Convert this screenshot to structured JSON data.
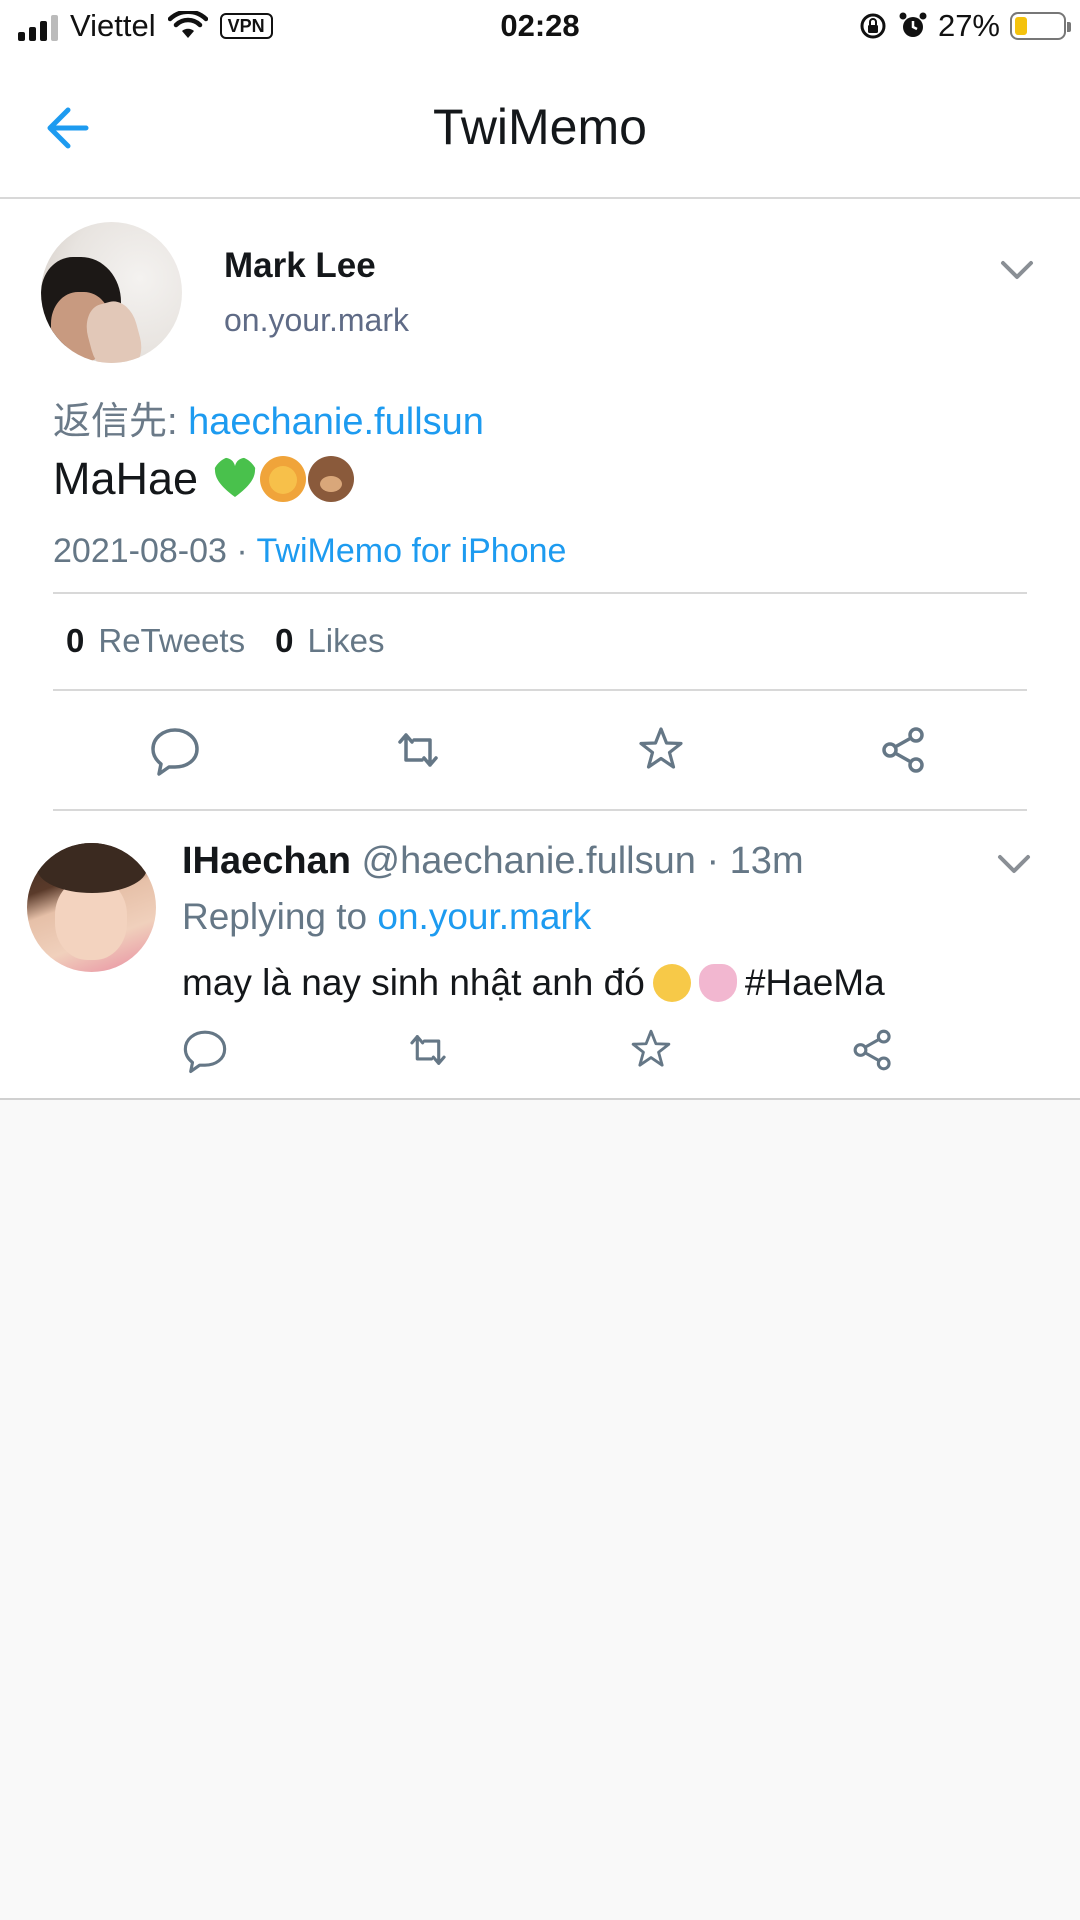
{
  "status_bar": {
    "carrier": "Viettel",
    "vpn": "VPN",
    "time": "02:28",
    "battery_percent": "27%",
    "battery_level": 0.27
  },
  "navbar": {
    "title": "TwiMemo",
    "back_icon": "back-arrow-icon"
  },
  "main_tweet": {
    "author_name": "Mark Lee",
    "author_handle": "on.your.mark",
    "reply_prefix": "返信先: ",
    "reply_to": "haechanie.fullsun",
    "text": "MaHae",
    "emojis": [
      "green-heart-emoji",
      "lion-emoji",
      "bear-emoji"
    ],
    "date": "2021-08-03",
    "separator": " · ",
    "source": "TwiMemo for iPhone",
    "retweets_count": "0",
    "retweets_label": "ReTweets",
    "likes_count": "0",
    "likes_label": "Likes"
  },
  "reply_tweet": {
    "author_name": "IHaechan",
    "author_handle": "@haechanie.fullsun",
    "time_sep": " · ",
    "time": "13m",
    "replying_label": "Replying to ",
    "replying_to": "on.your.mark",
    "text": "may là nay sinh nhật anh đó",
    "hashtag": "#HaeMa",
    "emojis": [
      "relieved-face-emoji",
      "lotus-position-emoji"
    ]
  },
  "colors": {
    "accent": "#1d9bf0",
    "text": "#14171a",
    "muted": "#657786",
    "handle": "#5f6b86",
    "background": "#f9f9f9",
    "divider": "#d8d8d8",
    "battery": "#f4c20d"
  },
  "actions": [
    "reply-icon",
    "retweet-icon",
    "favorite-star-icon",
    "share-icon"
  ]
}
